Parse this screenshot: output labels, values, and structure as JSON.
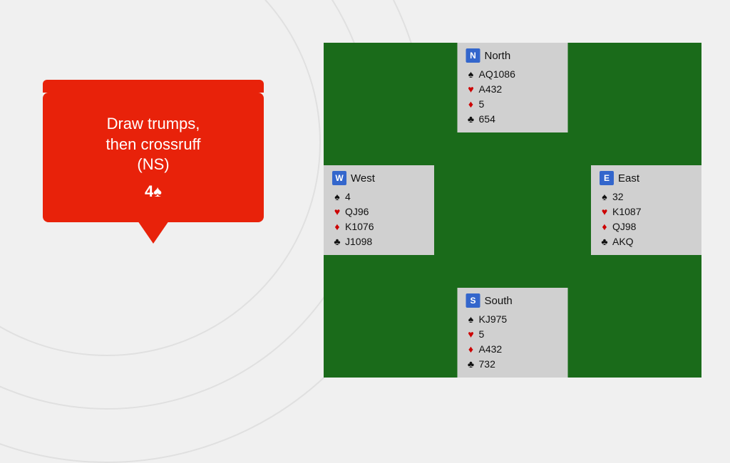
{
  "background": {
    "color": "#f0f0f0"
  },
  "speech_bubble": {
    "line1": "Draw trumps,",
    "line2": "then crossruff",
    "line3": "(NS)",
    "line4": "4",
    "spade": "♠"
  },
  "bridge": {
    "north": {
      "badge": "N",
      "name": "North",
      "spades": "AQ1086",
      "hearts": "A432",
      "diamonds": "5",
      "clubs": "654"
    },
    "south": {
      "badge": "S",
      "name": "South",
      "spades": "KJ975",
      "hearts": "5",
      "diamonds": "A432",
      "clubs": "732"
    },
    "west": {
      "badge": "W",
      "name": "West",
      "spades": "4",
      "hearts": "QJ96",
      "diamonds": "K1076",
      "clubs": "J1098"
    },
    "east": {
      "badge": "E",
      "name": "East",
      "spades": "32",
      "hearts": "K1087",
      "diamonds": "QJ98",
      "clubs": "AKQ"
    }
  }
}
